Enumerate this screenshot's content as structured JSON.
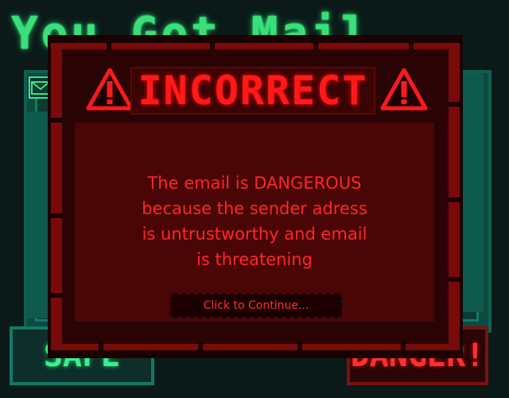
{
  "background": {
    "title": "You Got Mail",
    "safe_button": "SAFE",
    "danger_button": "DANGER!"
  },
  "modal": {
    "title": "INCORRECT",
    "message_lines": [
      "The email is DANGEROUS",
      "because the sender adress",
      "is untrustworthy and email",
      "is threatening"
    ],
    "continue_label": "Click to Continue..."
  },
  "colors": {
    "accent_red": "#ff1a1a",
    "accent_green": "#39e07a",
    "modal_bg": "#4a0606"
  },
  "icons": [
    "mail-icon",
    "warning-triangle-icon"
  ]
}
